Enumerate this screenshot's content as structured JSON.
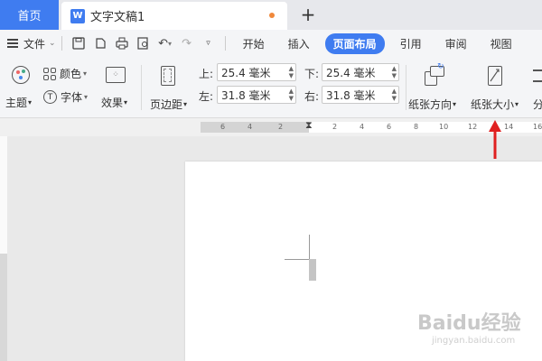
{
  "tabs": {
    "home_label": "首页",
    "doc_icon_letter": "W",
    "doc_title": "文字文稿1",
    "new_tab": "+"
  },
  "menu": {
    "file_label": "文件",
    "tabs": [
      "开始",
      "插入",
      "页面布局",
      "引用",
      "审阅",
      "视图"
    ],
    "active_tab": "页面布局",
    "accent_color": "#3f7cf0"
  },
  "ribbon": {
    "theme_label": "主题",
    "color_label": "颜色",
    "font_label": "字体",
    "effect_label": "效果",
    "margin_label": "页边距",
    "top_label": "上:",
    "top_value": "25.4 毫米",
    "bottom_label": "下:",
    "bottom_value": "25.4 毫米",
    "left_label": "左:",
    "left_value": "31.8 毫米",
    "right_label": "右:",
    "right_value": "31.8 毫米",
    "orientation_label": "纸张方向",
    "size_label": "纸张大小",
    "partial_label": "分"
  },
  "ruler": {
    "ticks": [
      "6",
      "4",
      "2",
      "2",
      "4",
      "6",
      "8",
      "10",
      "12",
      "14",
      "16"
    ]
  },
  "watermark": {
    "text": "Baidu经验",
    "sub": "jingyan.baidu.com"
  },
  "annotation_color": "#e02020"
}
